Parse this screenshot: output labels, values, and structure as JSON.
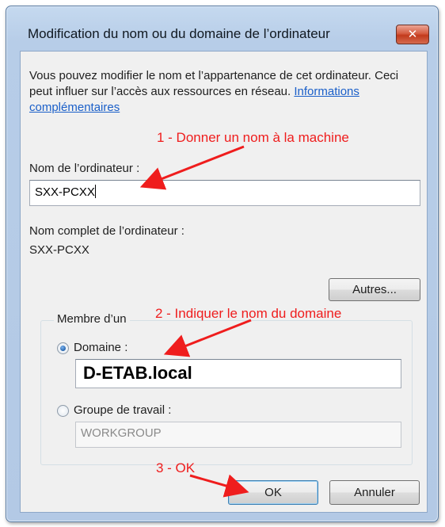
{
  "dialog": {
    "title": "Modification du nom ou du domaine de l’ordinateur",
    "close_icon": "close-icon",
    "description": "Vous pouvez modifier le nom et l’appartenance de cet ordinateur. Ceci peut influer sur l’accès aux ressources en réseau.",
    "more_info_link": "Informations complémentaires",
    "computer_name_label": "Nom de l’ordinateur :",
    "computer_name_value": "SXX-PCXX",
    "full_name_label": "Nom complet de l’ordinateur :",
    "full_name_value": "SXX-PCXX",
    "more_button": "Autres...",
    "member_of_label": "Membre d’un",
    "domain_radio_label": "Domaine :",
    "domain_value": "D-ETAB.local",
    "workgroup_radio_label": "Groupe de travail :",
    "workgroup_value": "WORKGROUP",
    "selected_option": "Domaine",
    "ok_button": "OK",
    "cancel_button": "Annuler"
  },
  "annotations": {
    "step1": "1 - Donner un nom à la machine",
    "step2": "2 - Indiquer le nom du domaine",
    "step3": "3 - OK"
  },
  "colors": {
    "annotation": "#ef1d1d",
    "link": "#1a5fc9",
    "title_bar": "#b7cde8"
  }
}
